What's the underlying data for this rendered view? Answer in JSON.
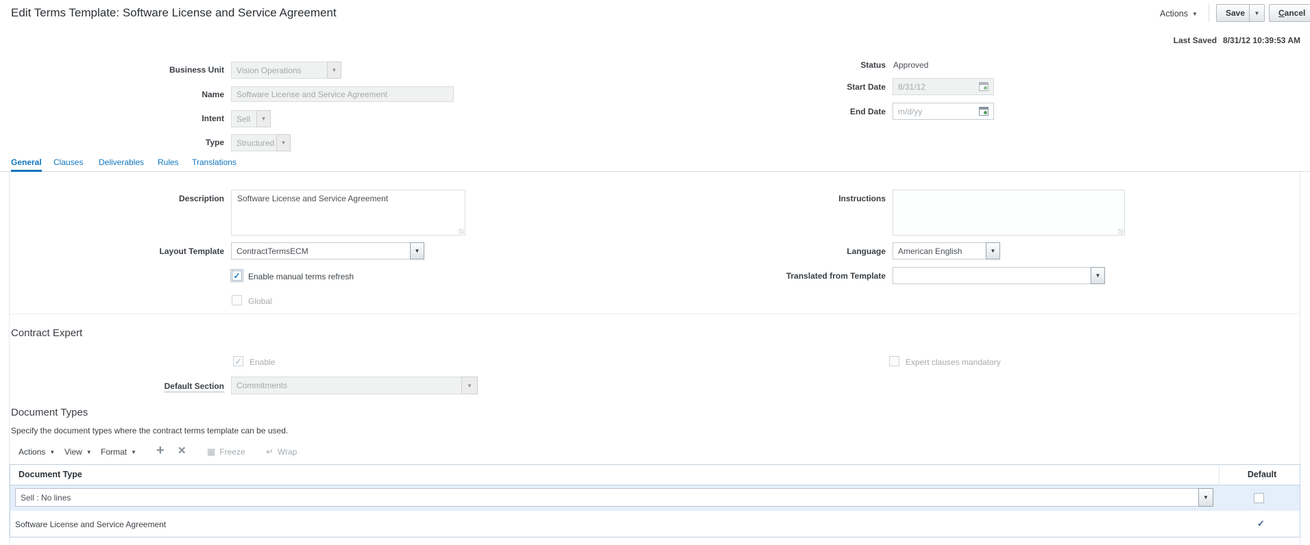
{
  "icons": {
    "caret": "▼",
    "plus": "+",
    "close": "✕",
    "freeze": "▦",
    "wrap": "↵",
    "check": "✓"
  },
  "colors": {
    "accent_blue": "#0f75bd",
    "selected_row": "#e4effb",
    "check_blue": "#0d7ad1",
    "row_check": "#44618d"
  },
  "header": {
    "title": "Edit Terms Template: Software License and Service Agreement",
    "actions_label": "Actions",
    "save_label": "Save",
    "cancel_label": "Cancel",
    "last_saved_label": "Last Saved",
    "last_saved_value": "8/31/12 10:39:53 AM"
  },
  "summary": {
    "business_unit": {
      "label": "Business Unit",
      "value": "Vision Operations"
    },
    "name": {
      "label": "Name",
      "value": "Software License and Service Agreement"
    },
    "intent": {
      "label": "Intent",
      "value": "Sell"
    },
    "type": {
      "label": "Type",
      "value": "Structured"
    },
    "status": {
      "label": "Status",
      "value": "Approved"
    },
    "start_date": {
      "label": "Start Date",
      "value": "8/31/12"
    },
    "end_date": {
      "label": "End Date",
      "placeholder": "m/d/yy"
    }
  },
  "tabs": {
    "general": "General",
    "clauses": "Clauses",
    "deliverables": "Deliverables",
    "rules": "Rules",
    "translations": "Translations"
  },
  "general_tab": {
    "description": {
      "label": "Description",
      "value": "Software License and Service Agreement"
    },
    "instructions": {
      "label": "Instructions",
      "value": ""
    },
    "layout_template": {
      "label": "Layout Template",
      "value": "ContractTermsECM"
    },
    "language": {
      "label": "Language",
      "value": "American English"
    },
    "enable_manual_terms_refresh": {
      "label": "Enable manual terms refresh",
      "checked": true
    },
    "translated_from_template": {
      "label": "Translated from Template",
      "value": ""
    },
    "global": {
      "label": "Global",
      "checked": false
    }
  },
  "contract_expert": {
    "heading": "Contract Expert",
    "enable": {
      "label": "Enable",
      "checked": true,
      "disabled": true
    },
    "expert_clauses_mandatory": {
      "label": "Expert clauses mandatory",
      "checked": false,
      "disabled": true
    },
    "default_section": {
      "label": "Default Section",
      "value": "Commitments"
    }
  },
  "document_types": {
    "heading": "Document Types",
    "description": "Specify the document types where the contract terms template can be used.",
    "toolbar": {
      "actions": "Actions",
      "view": "View",
      "format": "Format",
      "freeze": "Freeze",
      "wrap": "Wrap"
    },
    "columns": {
      "document_type": "Document Type",
      "default": "Default"
    },
    "rows": [
      {
        "document_type": "Sell : No lines",
        "selected": true,
        "default_checked": false
      },
      {
        "document_type": "Software License and Service Agreement",
        "default_checked": true
      }
    ]
  }
}
